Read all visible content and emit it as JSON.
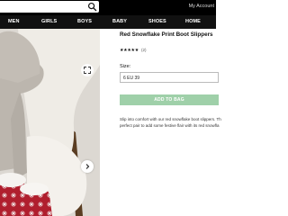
{
  "header": {
    "search_placeholder": "",
    "account_label": "My Account"
  },
  "nav": {
    "categories": [
      "MEN",
      "GIRLS",
      "BOYS",
      "BABY",
      "SHOES",
      "HOME"
    ]
  },
  "product": {
    "title": "Red Snowflake Print Boot Slippers",
    "rating_stars": "★★★★★",
    "rating": 5,
    "review_count": "(2)",
    "size_label": "Size:",
    "size_selected": "6 EU 39",
    "add_button": "ADD TO BAG",
    "description_line1": "Slip into comfort with our red snowflake boot slippers. Th",
    "description_line2": "perfect pair to add some festive flair with its red snowfla"
  },
  "icons": {
    "search": "search-icon",
    "expand": "expand-icon",
    "next": "chevron-right-icon"
  },
  "colors": {
    "topbar": "#000000",
    "nav": "#111111",
    "add_button": "#9fd0a9",
    "slipper_red": "#b01f2e"
  }
}
